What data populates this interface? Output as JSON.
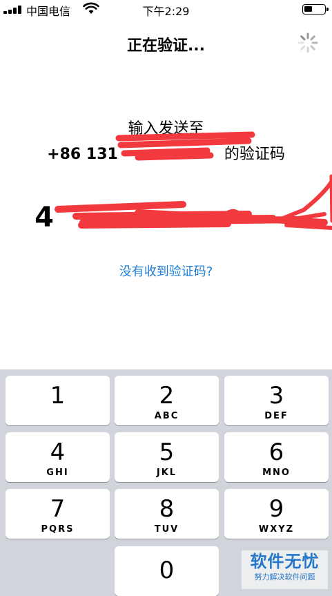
{
  "status_bar": {
    "carrier": "中国电信",
    "time": "下午2:29"
  },
  "nav": {
    "title": "正在验证..."
  },
  "prompt": {
    "line1": "输入发送至",
    "phone_prefix": "+86 131",
    "line2_suffix": "的验证码"
  },
  "code": {
    "visible_digit": "4"
  },
  "resend_link": "没有收到验证码?",
  "keypad": {
    "keys": [
      {
        "num": "1",
        "letters": ""
      },
      {
        "num": "2",
        "letters": "ABC"
      },
      {
        "num": "3",
        "letters": "DEF"
      },
      {
        "num": "4",
        "letters": "GHI"
      },
      {
        "num": "5",
        "letters": "JKL"
      },
      {
        "num": "6",
        "letters": "MNO"
      },
      {
        "num": "7",
        "letters": "PQRS"
      },
      {
        "num": "8",
        "letters": "TUV"
      },
      {
        "num": "9",
        "letters": "WXYZ"
      },
      {
        "num": "0",
        "letters": ""
      }
    ]
  },
  "watermark": {
    "main": "软件无忧",
    "sub": "努力解决软件问题"
  },
  "colors": {
    "link": "#1f7fd6",
    "scribble": "#f2393e",
    "keypad_bg": "#d1d4da"
  }
}
